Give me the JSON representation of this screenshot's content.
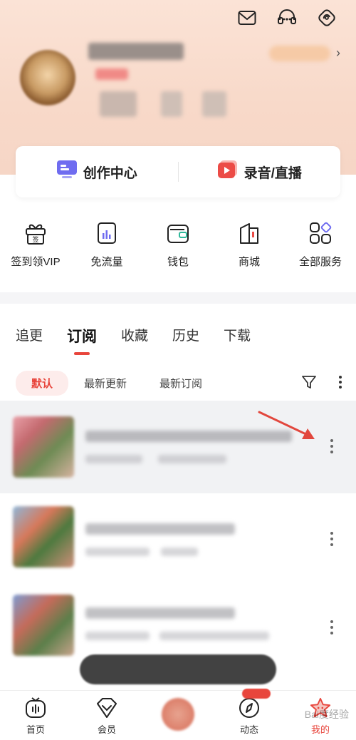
{
  "header": {
    "icons": [
      "mail-icon",
      "headset-icon",
      "settings-icon"
    ]
  },
  "create_card": {
    "left_label": "创作中心",
    "right_label": "录音/直播"
  },
  "services": [
    {
      "label": "签到领VIP",
      "icon": "gift-icon"
    },
    {
      "label": "免流量",
      "icon": "data-card-icon"
    },
    {
      "label": "钱包",
      "icon": "wallet-icon"
    },
    {
      "label": "商城",
      "icon": "store-icon"
    },
    {
      "label": "全部服务",
      "icon": "grid-icon"
    }
  ],
  "tabs": [
    "追更",
    "订阅",
    "收藏",
    "历史",
    "下载"
  ],
  "active_tab": "订阅",
  "filters": {
    "active": "默认",
    "options": [
      "最新更新",
      "最新订阅"
    ]
  },
  "bottom_nav": [
    {
      "label": "首页",
      "icon": "radio-icon"
    },
    {
      "label": "会员",
      "icon": "vip-diamond-icon"
    },
    {
      "label": "",
      "icon": "now-playing"
    },
    {
      "label": "动态",
      "icon": "compass-icon"
    },
    {
      "label": "我的",
      "icon": "star-mascot-icon"
    }
  ],
  "watermark": "Bai度经验",
  "colors": {
    "accent": "#e8453c",
    "hero_bg": "#fbe3d6",
    "highlight_row": "#f1f2f4",
    "arrow": "#e2473d"
  }
}
